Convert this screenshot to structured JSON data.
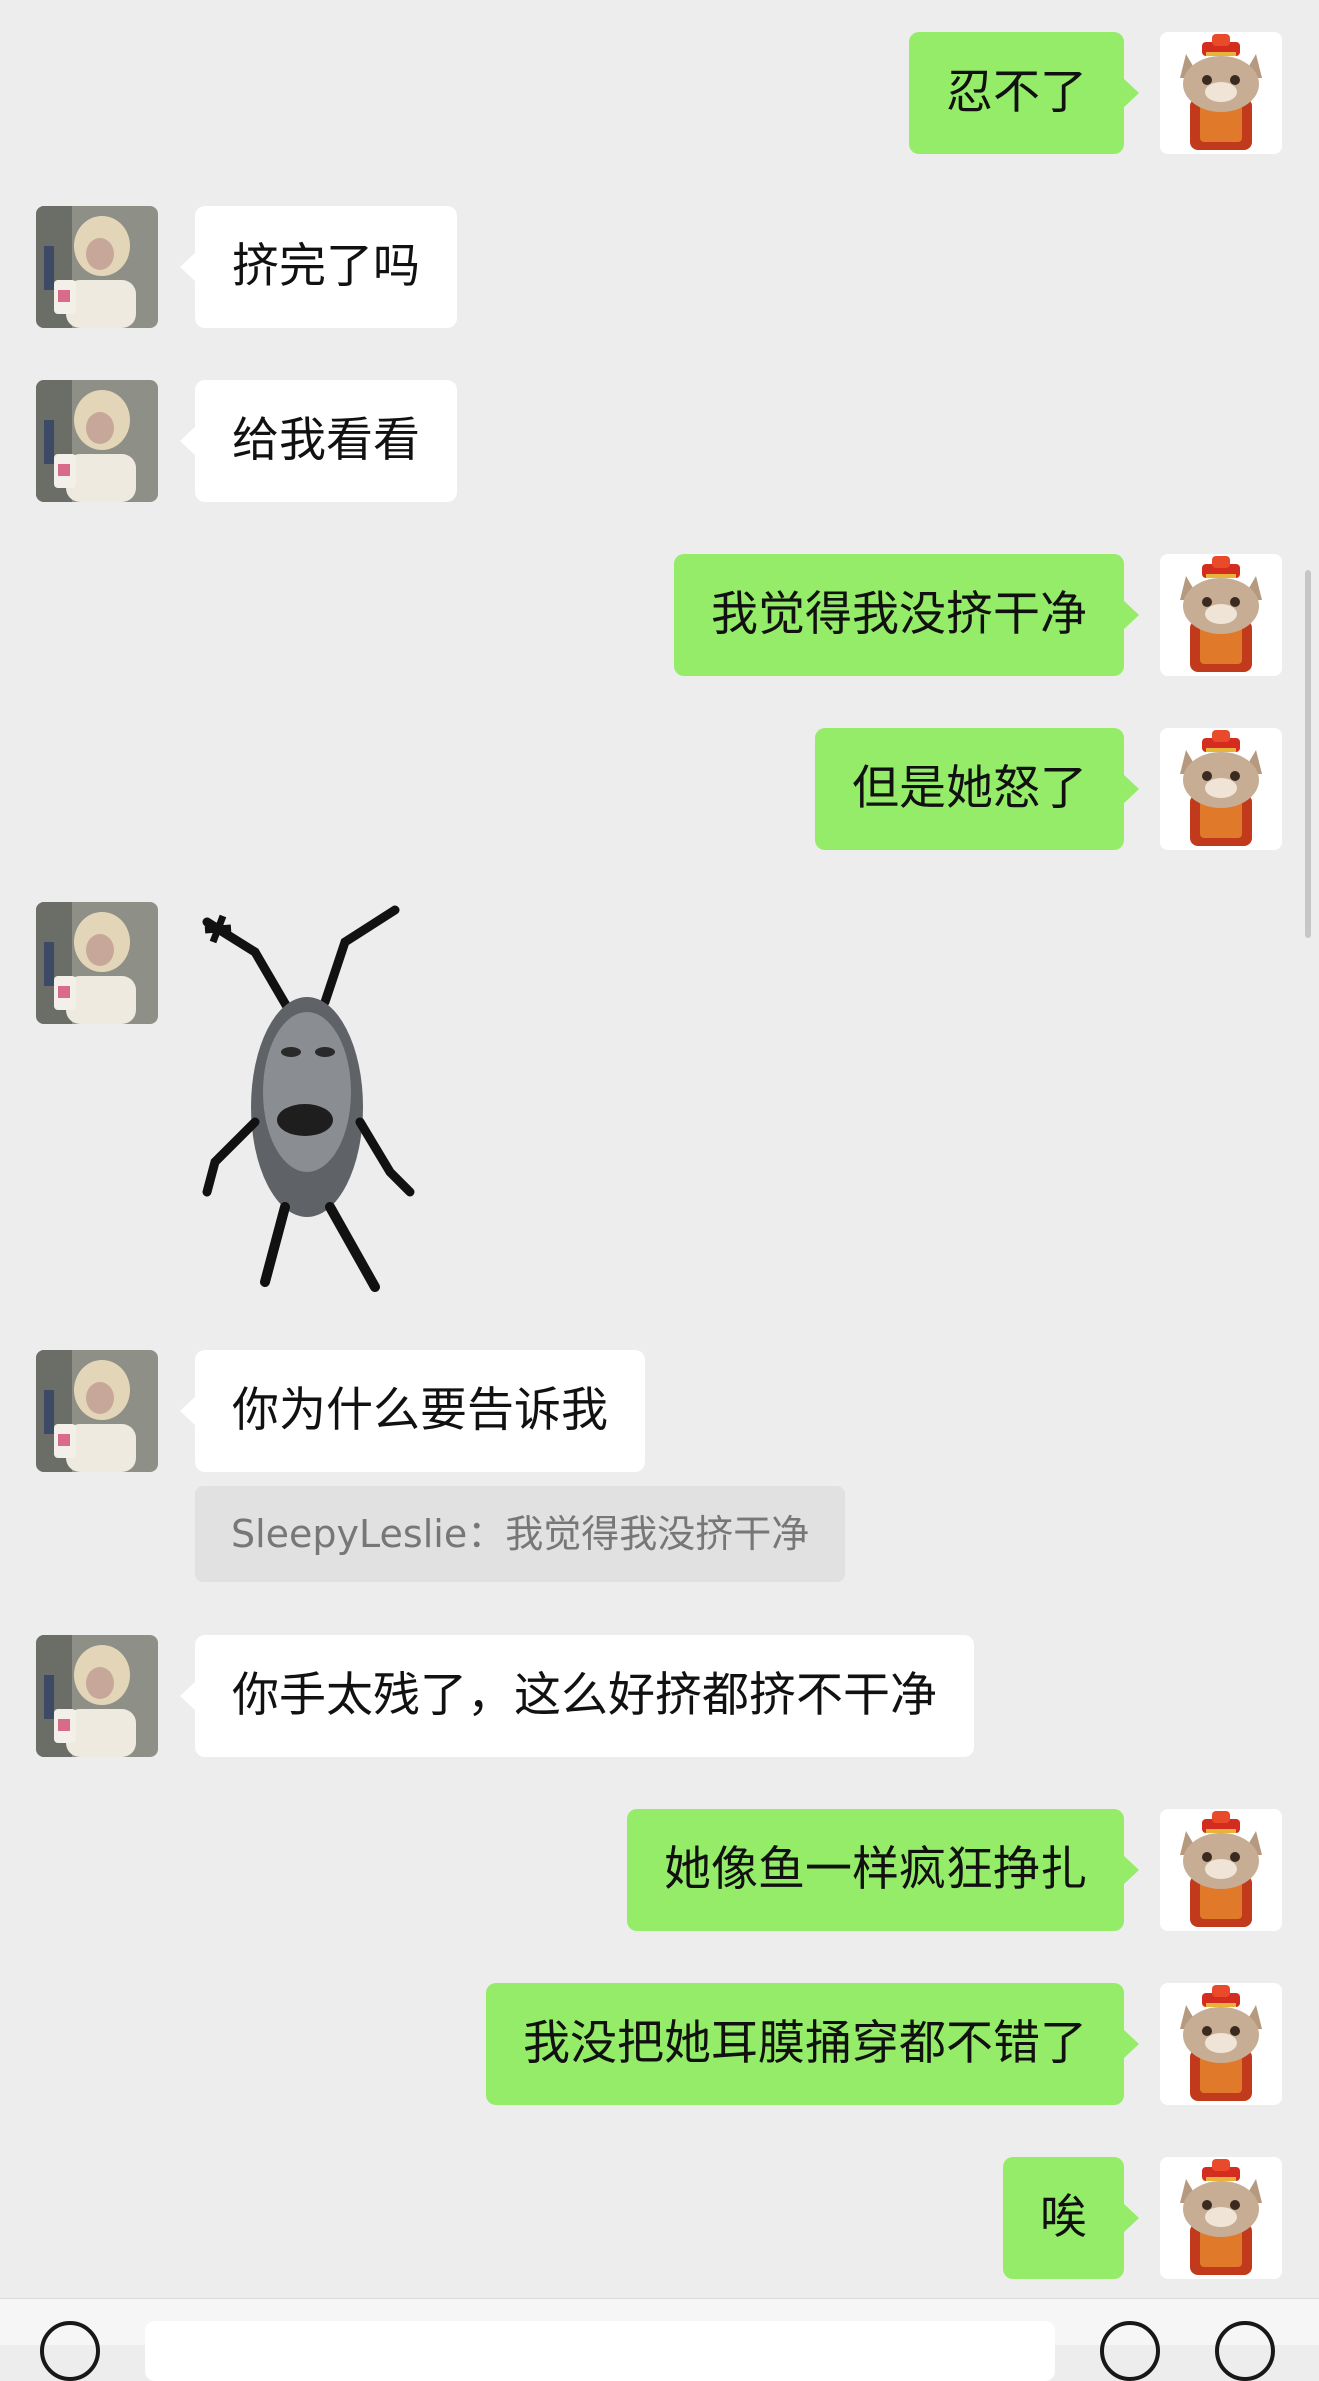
{
  "messages": [
    {
      "side": "sent",
      "text": "忍不了"
    },
    {
      "side": "recv",
      "text": "挤完了吗"
    },
    {
      "side": "recv",
      "text": "给我看看"
    },
    {
      "side": "sent",
      "text": "我觉得我没挤干净"
    },
    {
      "side": "sent",
      "text": "但是她怒了"
    },
    {
      "side": "recv",
      "type": "sticker",
      "sticker": "dancing-bug-sticker"
    },
    {
      "side": "recv",
      "text": "你为什么要告诉我",
      "quote": "SleepyLeslie：我觉得我没挤干净"
    },
    {
      "side": "recv",
      "text": "你手太残了，这么好挤都挤不干净"
    },
    {
      "side": "sent",
      "text": "她像鱼一样疯狂挣扎"
    },
    {
      "side": "sent",
      "text": "我没把她耳膜捅穿都不错了"
    },
    {
      "side": "sent",
      "text": "唉"
    }
  ],
  "colors": {
    "background": "#ededed",
    "sent_bubble": "#95ec69",
    "received_bubble": "#ffffff",
    "quote_box": "#e1e1e1"
  },
  "icons": {
    "self_avatar": "cat-avatar-icon",
    "contact_avatar": "contact-avatar-icon",
    "voice": "voice-icon",
    "emoji": "emoji-icon",
    "more": "plus-icon"
  }
}
